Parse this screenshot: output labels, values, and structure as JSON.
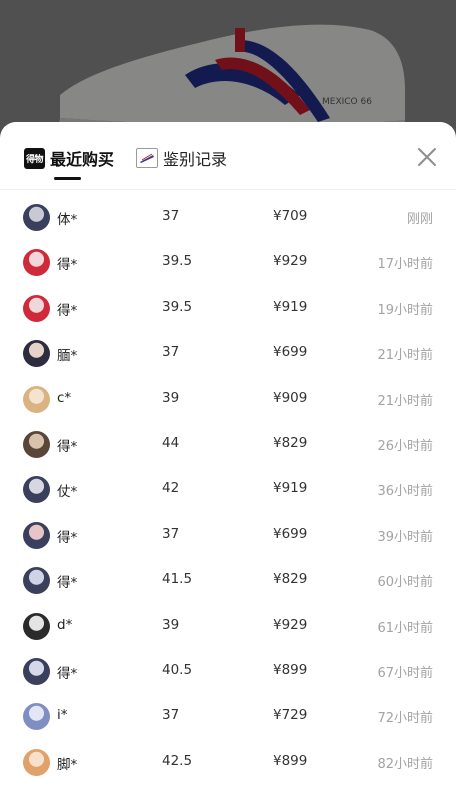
{
  "tabs": [
    {
      "label": "最近购买",
      "icon_text": "得物",
      "icon": "dewu-logo-icon",
      "active": true
    },
    {
      "label": "鉴别记录",
      "icon": "certificate-icon",
      "active": false
    }
  ],
  "close_icon": "close-icon",
  "rows": [
    {
      "avatar_colors": [
        "#3a3f5c",
        "#c9c9d6"
      ],
      "name": "体*",
      "size": "37",
      "price": "¥709",
      "time": "刚刚"
    },
    {
      "avatar_colors": [
        "#d02a3a",
        "#f1d6da"
      ],
      "name": "得*",
      "size": "39.5",
      "price": "¥929",
      "time": "17小时前"
    },
    {
      "avatar_colors": [
        "#d02a3a",
        "#f1d6da"
      ],
      "name": "得*",
      "size": "39.5",
      "price": "¥919",
      "time": "19小时前"
    },
    {
      "avatar_colors": [
        "#2d2d3f",
        "#e6d3c7"
      ],
      "name": "腼*",
      "size": "37",
      "price": "¥699",
      "time": "21小时前"
    },
    {
      "avatar_colors": [
        "#d9b382",
        "#f3e3cf"
      ],
      "name": "c*",
      "size": "39",
      "price": "¥909",
      "time": "21小时前"
    },
    {
      "avatar_colors": [
        "#5a4638",
        "#d8c2aa"
      ],
      "name": "得*",
      "size": "44",
      "price": "¥829",
      "time": "26小时前"
    },
    {
      "avatar_colors": [
        "#3a3f5c",
        "#d7d7e2"
      ],
      "name": "仗*",
      "size": "42",
      "price": "¥919",
      "time": "36小时前"
    },
    {
      "avatar_colors": [
        "#3a3f5c",
        "#e8c3c8"
      ],
      "name": "得*",
      "size": "37",
      "price": "¥699",
      "time": "39小时前"
    },
    {
      "avatar_colors": [
        "#3a3f5c",
        "#cfd3e6"
      ],
      "name": "得*",
      "size": "41.5",
      "price": "¥829",
      "time": "60小时前"
    },
    {
      "avatar_colors": [
        "#2b2b2b",
        "#e4e4e4"
      ],
      "name": "d*",
      "size": "39",
      "price": "¥929",
      "time": "61小时前"
    },
    {
      "avatar_colors": [
        "#3a3f5c",
        "#d4d8ea"
      ],
      "name": "得*",
      "size": "40.5",
      "price": "¥899",
      "time": "67小时前"
    },
    {
      "avatar_colors": [
        "#7f8fc4",
        "#e3e7f5"
      ],
      "name": "i*",
      "size": "37",
      "price": "¥729",
      "time": "72小时前"
    },
    {
      "avatar_colors": [
        "#e2a06a",
        "#f7e1cc"
      ],
      "name": "脚*",
      "size": "42.5",
      "price": "¥899",
      "time": "82小时前"
    }
  ]
}
